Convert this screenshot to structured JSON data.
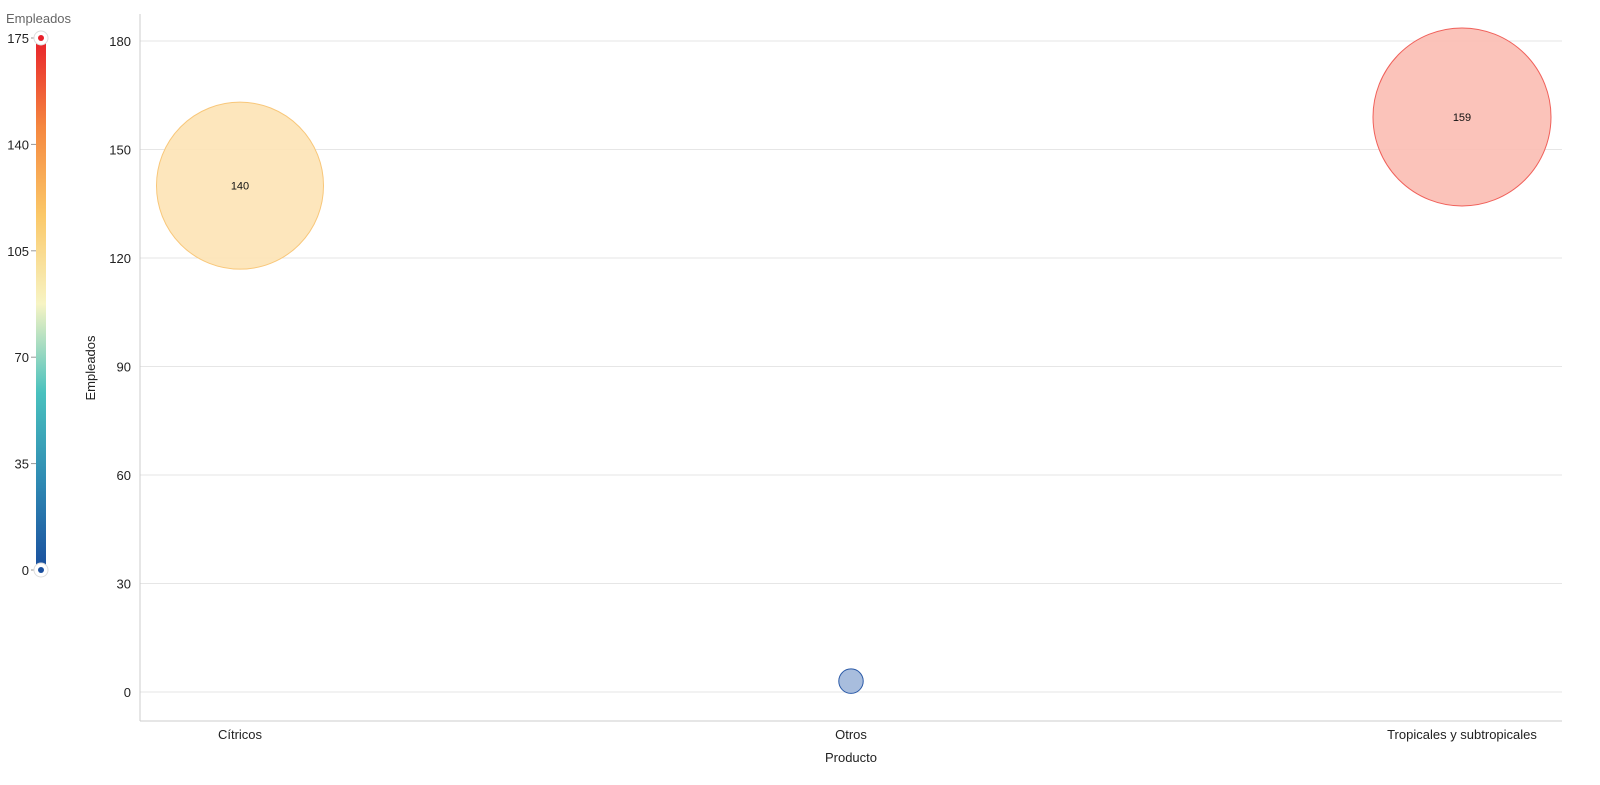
{
  "chart_data": {
    "type": "scatter",
    "xlabel": "Producto",
    "ylabel": "Empleados",
    "categories": [
      "Cítricos",
      "Otros",
      "Tropicales y subtropicales"
    ],
    "ylim": [
      -5,
      187
    ],
    "yticks": [
      0,
      30,
      60,
      90,
      120,
      150,
      180
    ],
    "grid": true,
    "points": [
      {
        "category": "Cítricos",
        "value": 140,
        "label": "140",
        "color": "#fde3b5",
        "stroke": "#f8c77a"
      },
      {
        "category": "Otros",
        "value": 3,
        "label": "",
        "color": "#9fb6d9",
        "stroke": "#2c5ba8"
      },
      {
        "category": "Tropicales y subtropicales",
        "value": 159,
        "label": "159",
        "color": "#fbbdb3",
        "stroke": "#f0605a"
      }
    ],
    "color_legend": {
      "title": "Empleados",
      "min": 0,
      "max": 175,
      "ticks": [
        0,
        35,
        70,
        105,
        140,
        175
      ],
      "position": "left",
      "stops": [
        "#1a4f9e",
        "#2f8ab3",
        "#49c1be",
        "#f7f4c4",
        "#fbc868",
        "#f5873f",
        "#e8202a"
      ],
      "min_marker_color": "#1a4f9e",
      "max_marker_color": "#e8202a"
    }
  }
}
